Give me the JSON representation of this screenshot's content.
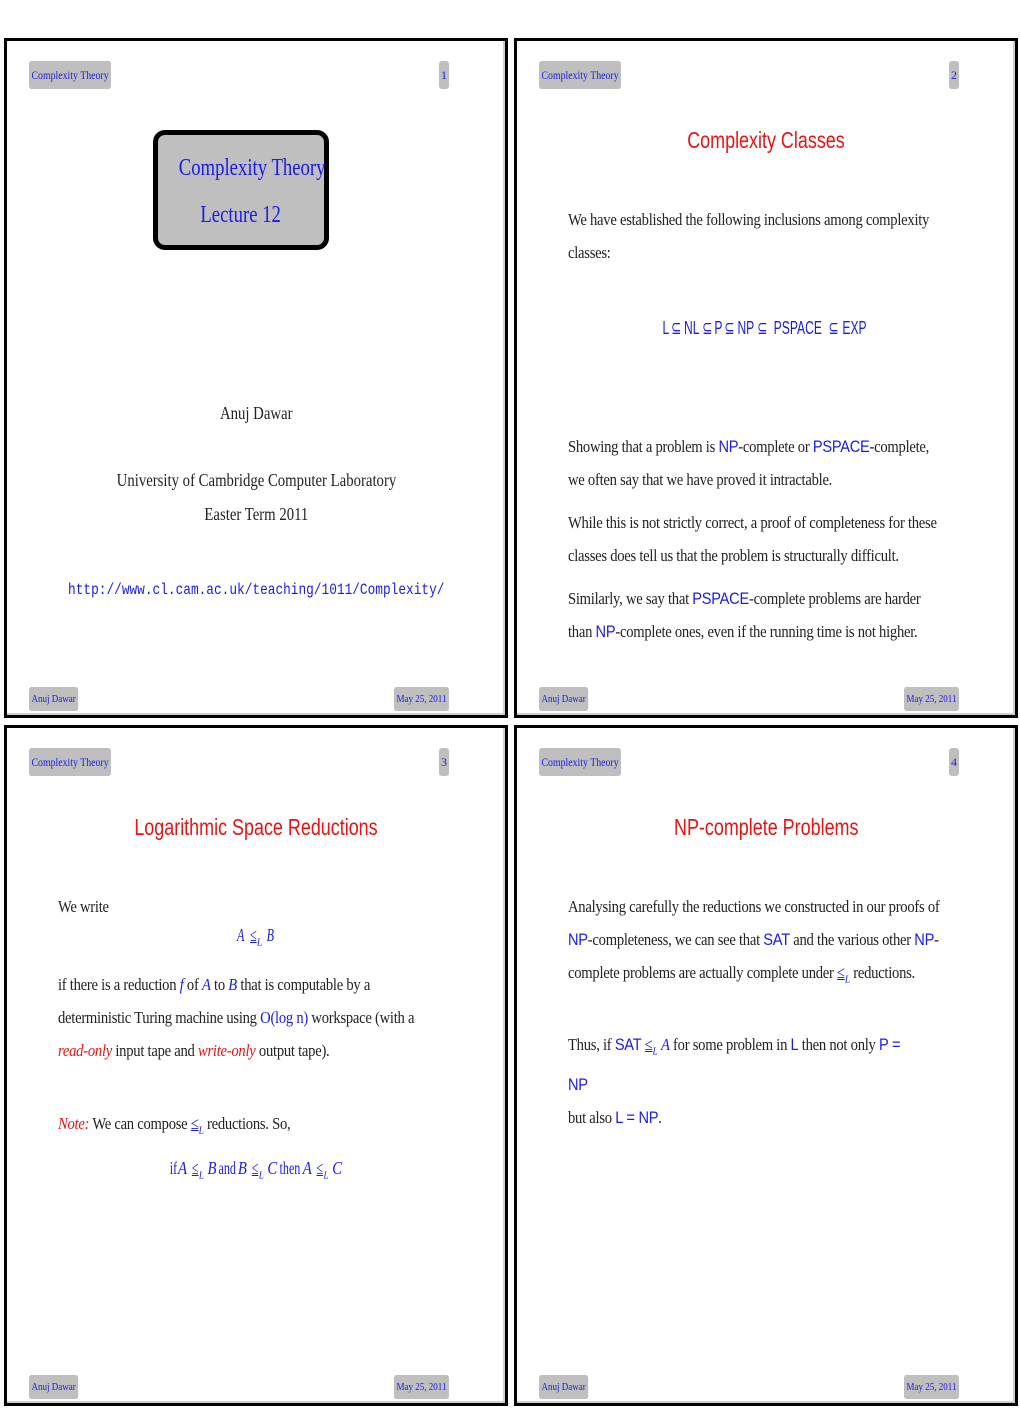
{
  "header_title": "Complexity Theory",
  "footer_author": "Anuj Dawar",
  "footer_date": "May 25, 2011",
  "slides": [
    {
      "number": "1",
      "title_box": {
        "line1": "Complexity Theory",
        "line2": "Lecture 12"
      },
      "author": "Anuj Dawar",
      "affiliation": "University of Cambridge Computer Laboratory",
      "term": "Easter Term 2011",
      "url": "http://www.cl.cam.ac.uk/teaching/1011/Complexity/"
    },
    {
      "number": "2",
      "title": "Complexity Classes",
      "intro": "We have established the following inclusions among complexity classes:",
      "inclusion_chain": [
        "L",
        "NL",
        "P",
        "NP",
        "PSPACE",
        "EXP"
      ],
      "subset_symbol": "⊆",
      "para1": {
        "pre": "Showing that a problem is ",
        "c1": "NP",
        "mid": "-complete or ",
        "c2": "PSPACE",
        "post": "-complete, we often say that we have proved it intractable."
      },
      "para2": "While this is not strictly correct, a proof of completeness for these classes does tell us that the problem is structurally difficult.",
      "para3": {
        "pre": "Similarly, we say that ",
        "c1": "PSPACE",
        "mid": "-complete problems are harder than ",
        "c2": "NP",
        "post": "-complete ones, even if the running time is not higher."
      }
    },
    {
      "number": "3",
      "title": "Logarithmic Space Reductions",
      "we_write": "We write",
      "relation": {
        "a": "A",
        "op": "≤",
        "sub": "L",
        "b": "B"
      },
      "def": {
        "t1": " if there is a reduction ",
        "f": "f",
        "t2": " of ",
        "a": "A",
        "t3": " to ",
        "b": "B",
        "t4": " that is computable by a deterministic Turing machine using ",
        "olog": "O(log n)",
        "t5": " workspace (with a ",
        "ro": "read-only",
        "t6": " input tape and ",
        "wo": "write-only",
        "t7": " output tape)."
      },
      "note_label": "Note:",
      "note_pre": " We can compose ",
      "note_post": " reductions. So,",
      "compose": {
        "if": "if ",
        "and": " and ",
        "then": " then "
      }
    },
    {
      "number": "4",
      "title": "NP-complete Problems",
      "para1": {
        "t1": "Analysing carefully the reductions we constructed in our proofs of ",
        "np": "NP",
        "t2": "-completeness, we can see that ",
        "sat": "SAT",
        "t3": " and the various other ",
        "t4": "-complete problems are actually complete under ",
        "t5": " reductions."
      },
      "para2": {
        "t1": "Thus, if ",
        "sat": "SAT",
        "a": "A",
        "t2": " for some problem in ",
        "l": "L",
        "t3": " then not only ",
        "p_eq_np": "P = NP",
        "t4": "but also ",
        "l_eq_np": "L = NP",
        "t5": "."
      }
    }
  ]
}
